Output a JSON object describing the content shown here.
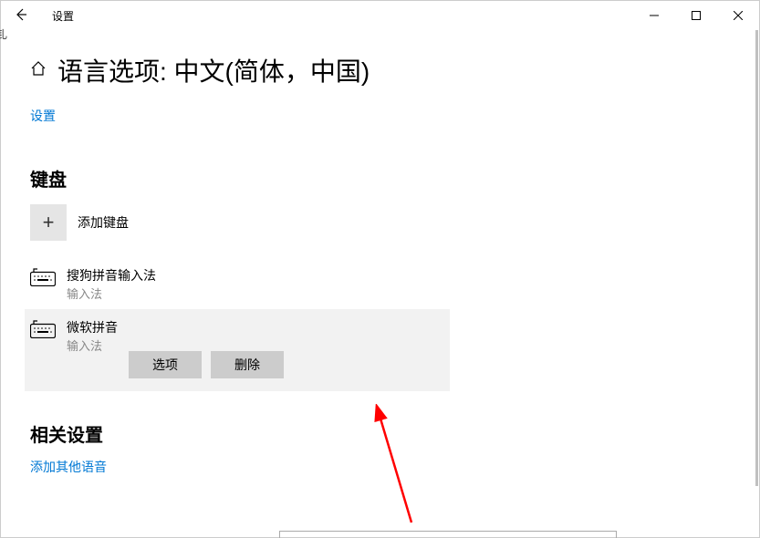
{
  "window": {
    "title": "设置"
  },
  "page": {
    "title": "语言选项: 中文(简体，中国)",
    "settings_link": "设置"
  },
  "keyboard_section": {
    "title": "键盘",
    "add_label": "添加键盘",
    "items": [
      {
        "name": "搜狗拼音输入法",
        "type": "输入法"
      },
      {
        "name": "微软拼音",
        "type": "输入法"
      }
    ],
    "actions": {
      "options": "选项",
      "remove": "删除"
    }
  },
  "related_section": {
    "title": "相关设置",
    "link": "添加其他语音"
  },
  "edge_text": "钆"
}
